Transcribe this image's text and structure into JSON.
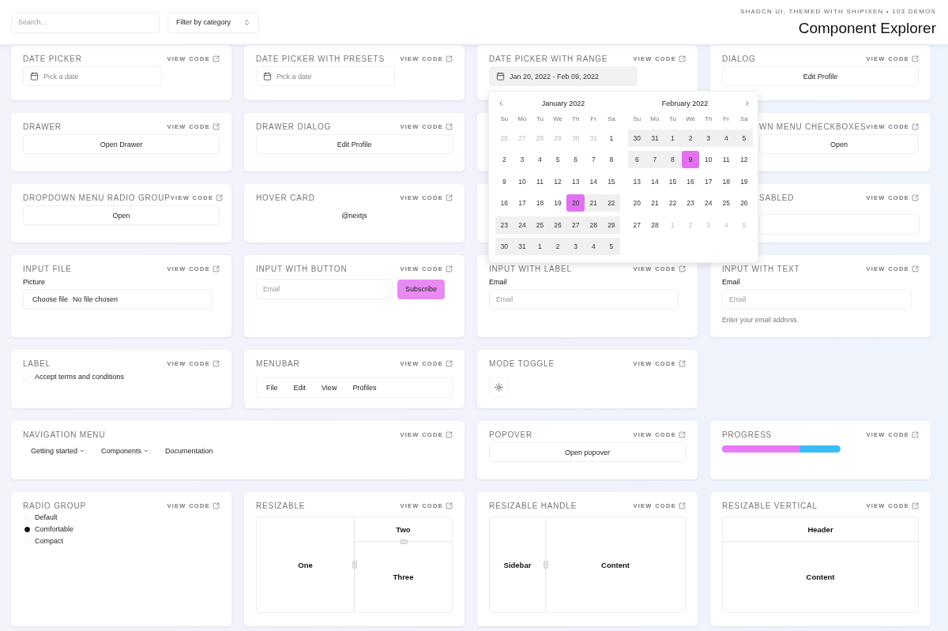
{
  "header": {
    "search": {
      "placeholder": "Search..."
    },
    "filter": {
      "value": "Filter by category"
    },
    "subtitle": "SHADCN UI, THEMED WITH SHIPIXEN • 103 DEMOS",
    "title": "Component Explorer"
  },
  "cards": [
    {
      "kind": "date_button",
      "title": "DATE PICKER",
      "view_code": "VIEW CODE",
      "label": "Pick a date",
      "filled": false
    },
    {
      "kind": "date_button",
      "title": "DATE PICKER WITH PRESETS",
      "view_code": "VIEW CODE",
      "label": "Pick a date",
      "filled": false
    },
    {
      "kind": "date_button",
      "title": "DATE PICKER WITH RANGE",
      "view_code": "VIEW CODE",
      "label": "Jan 20, 2022 - Feb 09, 2022",
      "filled": true
    },
    {
      "kind": "button",
      "title": "DIALOG",
      "view_code": "VIEW CODE",
      "label": "Edit Profile"
    },
    {
      "kind": "button",
      "title": "DRAWER",
      "view_code": "VIEW CODE",
      "label": "Open Drawer"
    },
    {
      "kind": "button",
      "title": "DRAWER DIALOG",
      "view_code": "VIEW CODE",
      "label": "Edit Profile"
    },
    {
      "kind": "covered"
    },
    {
      "kind": "button",
      "title": "WN MENU CHECKBOXES",
      "view_code": "VIEW CODE",
      "label": "Open",
      "covered_left": true
    },
    {
      "kind": "button",
      "title": "DROPDOWN MENU RADIO GROUP",
      "view_code": "VIEW CODE",
      "label": "Open"
    },
    {
      "kind": "link_text",
      "title": "HOVER CARD",
      "view_code": "VIEW CODE",
      "label": "@nextjs"
    },
    {
      "kind": "covered"
    },
    {
      "kind": "disabled_input",
      "title": "SABLED",
      "view_code": "VIEW CODE",
      "covered_left": true
    },
    {
      "kind": "file_input",
      "title": "INPUT FILE",
      "view_code": "VIEW CODE",
      "label": "Picture",
      "button": "Choose file",
      "status": "No file chosen"
    },
    {
      "kind": "input_button",
      "title": "INPUT WITH BUTTON",
      "view_code": "VIEW CODE",
      "placeholder": "Email",
      "button": "Subscribe"
    },
    {
      "kind": "input_label",
      "title": "INPUT WITH LABEL",
      "view_code": "VIEW CODE",
      "label": "Email",
      "placeholder": "Email"
    },
    {
      "kind": "input_label",
      "title": "INPUT WITH TEXT",
      "view_code": "VIEW CODE",
      "label": "Email",
      "placeholder": "Email",
      "help": "Enter your email address."
    },
    {
      "kind": "checkbox",
      "title": "LABEL",
      "view_code": "VIEW CODE",
      "label": "Accept terms and conditions",
      "checked": false
    },
    {
      "kind": "menubar",
      "title": "MENUBAR",
      "view_code": "VIEW CODE",
      "items": [
        "File",
        "Edit",
        "View",
        "Profiles"
      ]
    },
    {
      "kind": "icon_button",
      "title": "MODE TOGGLE",
      "view_code": "VIEW CODE"
    },
    {
      "kind": "nav_menu",
      "title": "NAVIGATION MENU",
      "view_code": "VIEW CODE",
      "wide": true,
      "items": [
        {
          "label": "Getting started",
          "expandable": true
        },
        {
          "label": "Components",
          "expandable": true
        },
        {
          "label": "Documentation",
          "expandable": false
        }
      ]
    },
    {
      "kind": "button",
      "title": "POPOVER",
      "view_code": "VIEW CODE",
      "label": "Open popover"
    },
    {
      "kind": "progress",
      "title": "PROGRESS",
      "view_code": "VIEW CODE",
      "level": 0.66
    },
    {
      "kind": "radio",
      "title": "RADIO GROUP",
      "view_code": "VIEW CODE",
      "options": [
        {
          "label": "Default",
          "selected": false
        },
        {
          "label": "Comfortable",
          "selected": true
        },
        {
          "label": "Compact",
          "selected": false
        }
      ]
    },
    {
      "kind": "resizable",
      "title": "RESIZABLE",
      "view_code": "VIEW CODE",
      "panels": [
        "One",
        "Two",
        "Three"
      ]
    },
    {
      "kind": "resizable_handle",
      "title": "RESIZABLE HANDLE",
      "view_code": "VIEW CODE",
      "panels": [
        "Sidebar",
        "Content"
      ]
    },
    {
      "kind": "resizable_vertical",
      "title": "RESIZABLE VERTICAL",
      "view_code": "VIEW CODE",
      "panels": [
        "Header",
        "Content"
      ]
    }
  ],
  "calendar": {
    "months": [
      {
        "title": "January 2022",
        "weekdays": [
          "Su",
          "Mo",
          "Tu",
          "We",
          "Th",
          "Fr",
          "Sa"
        ],
        "weeks": [
          [
            {
              "d": "26",
              "outside": true,
              "in_range": false,
              "selected": false
            },
            {
              "d": "27",
              "outside": true,
              "in_range": false,
              "selected": false
            },
            {
              "d": "28",
              "outside": true,
              "in_range": false,
              "selected": false
            },
            {
              "d": "29",
              "outside": true,
              "in_range": false,
              "selected": false
            },
            {
              "d": "30",
              "outside": true,
              "in_range": false,
              "selected": false
            },
            {
              "d": "31",
              "outside": true,
              "in_range": false,
              "selected": false
            },
            {
              "d": "1",
              "outside": false,
              "in_range": false,
              "selected": false
            }
          ],
          [
            {
              "d": "2",
              "outside": false,
              "in_range": false,
              "selected": false
            },
            {
              "d": "3",
              "outside": false,
              "in_range": false,
              "selected": false
            },
            {
              "d": "4",
              "outside": false,
              "in_range": false,
              "selected": false
            },
            {
              "d": "5",
              "outside": false,
              "in_range": false,
              "selected": false
            },
            {
              "d": "6",
              "outside": false,
              "in_range": false,
              "selected": false
            },
            {
              "d": "7",
              "outside": false,
              "in_range": false,
              "selected": false
            },
            {
              "d": "8",
              "outside": false,
              "in_range": false,
              "selected": false
            }
          ],
          [
            {
              "d": "9",
              "outside": false,
              "in_range": false,
              "selected": false
            },
            {
              "d": "10",
              "outside": false,
              "in_range": false,
              "selected": false
            },
            {
              "d": "11",
              "outside": false,
              "in_range": false,
              "selected": false
            },
            {
              "d": "12",
              "outside": false,
              "in_range": false,
              "selected": false
            },
            {
              "d": "13",
              "outside": false,
              "in_range": false,
              "selected": false
            },
            {
              "d": "14",
              "outside": false,
              "in_range": false,
              "selected": false
            },
            {
              "d": "15",
              "outside": false,
              "in_range": false,
              "selected": false
            }
          ],
          [
            {
              "d": "16",
              "outside": false,
              "in_range": false,
              "selected": false
            },
            {
              "d": "17",
              "outside": false,
              "in_range": false,
              "selected": false
            },
            {
              "d": "18",
              "outside": false,
              "in_range": false,
              "selected": false
            },
            {
              "d": "19",
              "outside": false,
              "in_range": false,
              "selected": false
            },
            {
              "d": "20",
              "outside": false,
              "in_range": true,
              "selected": true
            },
            {
              "d": "21",
              "outside": false,
              "in_range": true,
              "selected": false
            },
            {
              "d": "22",
              "outside": false,
              "in_range": true,
              "selected": false
            }
          ],
          [
            {
              "d": "23",
              "outside": false,
              "in_range": true,
              "selected": false
            },
            {
              "d": "24",
              "outside": false,
              "in_range": true,
              "selected": false
            },
            {
              "d": "25",
              "outside": false,
              "in_range": true,
              "selected": false
            },
            {
              "d": "26",
              "outside": false,
              "in_range": true,
              "selected": false
            },
            {
              "d": "27",
              "outside": false,
              "in_range": true,
              "selected": false
            },
            {
              "d": "28",
              "outside": false,
              "in_range": true,
              "selected": false
            },
            {
              "d": "29",
              "outside": false,
              "in_range": true,
              "selected": false
            }
          ],
          [
            {
              "d": "30",
              "outside": false,
              "in_range": true,
              "selected": false
            },
            {
              "d": "31",
              "outside": false,
              "in_range": true,
              "selected": false
            },
            {
              "d": "1",
              "outside": false,
              "in_range": true,
              "selected": false
            },
            {
              "d": "2",
              "outside": false,
              "in_range": true,
              "selected": false
            },
            {
              "d": "3",
              "outside": false,
              "in_range": true,
              "selected": false
            },
            {
              "d": "4",
              "outside": false,
              "in_range": true,
              "selected": false
            },
            {
              "d": "5",
              "outside": false,
              "in_range": true,
              "selected": false
            }
          ]
        ]
      },
      {
        "title": "February 2022",
        "weekdays": [
          "Su",
          "Mo",
          "Tu",
          "We",
          "Th",
          "Fr",
          "Sa"
        ],
        "weeks": [
          [
            {
              "d": "30",
              "outside": false,
              "in_range": true,
              "selected": false
            },
            {
              "d": "31",
              "outside": false,
              "in_range": true,
              "selected": false
            },
            {
              "d": "1",
              "outside": false,
              "in_range": true,
              "selected": false
            },
            {
              "d": "2",
              "outside": false,
              "in_range": true,
              "selected": false
            },
            {
              "d": "3",
              "outside": false,
              "in_range": true,
              "selected": false
            },
            {
              "d": "4",
              "outside": false,
              "in_range": true,
              "selected": false
            },
            {
              "d": "5",
              "outside": false,
              "in_range": true,
              "selected": false
            }
          ],
          [
            {
              "d": "6",
              "outside": false,
              "in_range": true,
              "selected": false
            },
            {
              "d": "7",
              "outside": false,
              "in_range": true,
              "selected": false
            },
            {
              "d": "8",
              "outside": false,
              "in_range": true,
              "selected": false
            },
            {
              "d": "9",
              "outside": false,
              "in_range": true,
              "selected": true
            },
            {
              "d": "10",
              "outside": false,
              "in_range": false,
              "selected": false
            },
            {
              "d": "11",
              "outside": false,
              "in_range": false,
              "selected": false
            },
            {
              "d": "12",
              "outside": false,
              "in_range": false,
              "selected": false
            }
          ],
          [
            {
              "d": "13",
              "outside": false,
              "in_range": false,
              "selected": false
            },
            {
              "d": "14",
              "outside": false,
              "in_range": false,
              "selected": false
            },
            {
              "d": "15",
              "outside": false,
              "in_range": false,
              "selected": false
            },
            {
              "d": "16",
              "outside": false,
              "in_range": false,
              "selected": false
            },
            {
              "d": "17",
              "outside": false,
              "in_range": false,
              "selected": false
            },
            {
              "d": "18",
              "outside": false,
              "in_range": false,
              "selected": false
            },
            {
              "d": "19",
              "outside": false,
              "in_range": false,
              "selected": false
            }
          ],
          [
            {
              "d": "20",
              "outside": false,
              "in_range": false,
              "selected": false
            },
            {
              "d": "21",
              "outside": false,
              "in_range": false,
              "selected": false
            },
            {
              "d": "22",
              "outside": false,
              "in_range": false,
              "selected": false
            },
            {
              "d": "23",
              "outside": false,
              "in_range": false,
              "selected": false
            },
            {
              "d": "24",
              "outside": false,
              "in_range": false,
              "selected": false
            },
            {
              "d": "25",
              "outside": false,
              "in_range": false,
              "selected": false
            },
            {
              "d": "26",
              "outside": false,
              "in_range": false,
              "selected": false
            }
          ],
          [
            {
              "d": "27",
              "outside": false,
              "in_range": false,
              "selected": false
            },
            {
              "d": "28",
              "outside": false,
              "in_range": false,
              "selected": false
            },
            {
              "d": "1",
              "outside": true,
              "in_range": false,
              "selected": false
            },
            {
              "d": "2",
              "outside": true,
              "in_range": false,
              "selected": false
            },
            {
              "d": "3",
              "outside": true,
              "in_range": false,
              "selected": false
            },
            {
              "d": "4",
              "outside": true,
              "in_range": false,
              "selected": false
            },
            {
              "d": "5",
              "outside": true,
              "in_range": false,
              "selected": false
            }
          ]
        ]
      }
    ]
  }
}
